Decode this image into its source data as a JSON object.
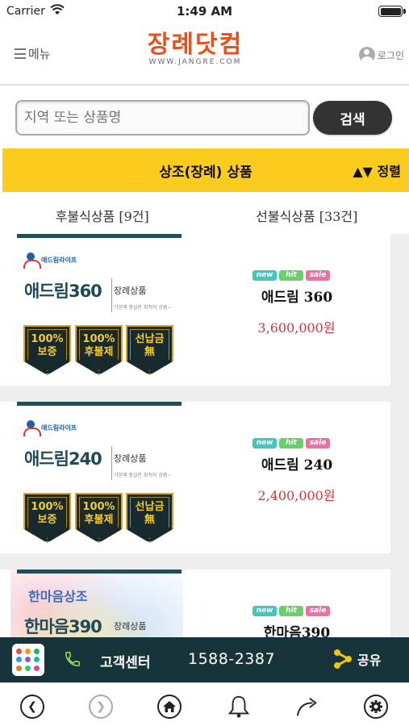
{
  "status_bar": {
    "carrier": "Carrier",
    "time": "1:49 AM"
  },
  "header": {
    "menu_label": "메뉴",
    "logo_main": "장례닷컴",
    "logo_sub": "WWW.JANGRE.COM",
    "login_label": "로그인"
  },
  "search": {
    "placeholder": "지역 또는 상품명",
    "button_label": "검색"
  },
  "category": {
    "title": "상조(장례) 상품",
    "sort_label": "▲▼ 정렬"
  },
  "tabs": [
    {
      "label": "후불식상품 [9건]"
    },
    {
      "label": "선불식상품 [33건]"
    }
  ],
  "products": [
    {
      "brand": "애드림라이프",
      "image_name": "애드림360",
      "image_type": "장례상품",
      "image_desc": "기본에 충실한 최적의 상품~",
      "badges": [
        {
          "line1": "100%",
          "line2": "보증"
        },
        {
          "line1": "100%",
          "line2": "후불제"
        },
        {
          "line1": "선납금",
          "line2": "無"
        }
      ],
      "tags": [
        "new",
        "hit",
        "sale"
      ],
      "name": "애드림 360",
      "price": "3,600,000원"
    },
    {
      "brand": "애드림라이프",
      "image_name": "애드림240",
      "image_type": "장례상품",
      "image_desc": "기본에 충실한 최적의 상품~",
      "badges": [
        {
          "line1": "100%",
          "line2": "보증"
        },
        {
          "line1": "100%",
          "line2": "후불제"
        },
        {
          "line1": "선납금",
          "line2": "無"
        }
      ],
      "tags": [
        "new",
        "hit",
        "sale"
      ],
      "name": "애드림 240",
      "price": "2,400,000원"
    },
    {
      "brand": "한마음상조",
      "image_name": "한마음390",
      "image_type": "장례상품",
      "tags": [
        "new",
        "hit",
        "sale"
      ],
      "name": "한마음390"
    }
  ],
  "footer": {
    "customer_center": "고객센터",
    "phone": "1588-2387",
    "share_label": "공유"
  },
  "colors": {
    "accent_orange": "#e8501c",
    "category_yellow": "#fbcb1e",
    "footer_dark": "#17343a",
    "price_red": "#d8343a"
  }
}
